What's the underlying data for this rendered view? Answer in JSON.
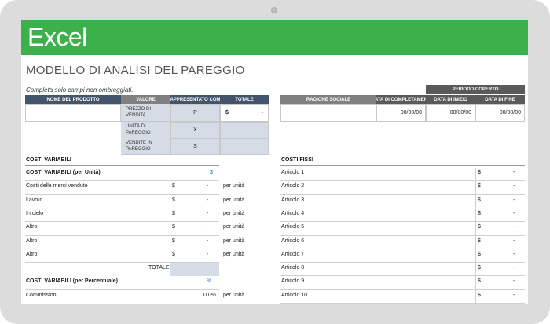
{
  "app": {
    "name": "Excel",
    "accent": "#3cb04b"
  },
  "page_title": "MODELLO DI ANALISI DEL PAREGGIO",
  "instructions": "Completa solo campi non ombreggiati.",
  "product_table": {
    "headers": [
      "NOME DEL PRODOTTO",
      "VALORE",
      "APPRESENTATO COM",
      "TOTALE"
    ],
    "rows": [
      {
        "label": "PREZZO DI VENDITA",
        "symbol": "P"
      },
      {
        "label": "UNITÀ DI PAREGGIO",
        "symbol": "X"
      },
      {
        "label": "VENDITE IN PAREGGIO",
        "symbol": "S"
      }
    ],
    "total_currency": "$",
    "total_value": "-"
  },
  "period_table": {
    "title": "PERIODO COPERTO",
    "headers": [
      "RAGIONE SOCIALE",
      "ATA DI COMPLETAMEN",
      "DATA DI INIZIO",
      "DATA DI FINE"
    ],
    "dates": [
      "00/00/00",
      "00/00/00",
      "00/00/00"
    ]
  },
  "variable_costs": {
    "title": "COSTI VARIABILI",
    "per_unit_title": "COSTI VARIABILI (per Unità)",
    "per_unit_symbol": "$",
    "unit_suffix": "per unità",
    "currency": "$",
    "items": [
      {
        "label": "Costi delle merci vendute",
        "value": "-"
      },
      {
        "label": "Lavoro",
        "value": "-"
      },
      {
        "label": "In cielo",
        "value": "-"
      },
      {
        "label": "Altro",
        "value": "-"
      },
      {
        "label": "Altro",
        "value": "-"
      },
      {
        "label": "Altro",
        "value": "-"
      }
    ],
    "total_label": "TOTALE",
    "percent_title": "COSTI VARIABILI (per Percentuale)",
    "percent_symbol": "%",
    "commission_label": "Commissioni",
    "commission_value": "0.0%"
  },
  "fixed_costs": {
    "title": "COSTI FISSI",
    "currency": "$",
    "items": [
      {
        "label": "Articolo 1",
        "value": "-"
      },
      {
        "label": "Articolo 2",
        "value": "-"
      },
      {
        "label": "Articolo 3",
        "value": "-"
      },
      {
        "label": "Articolo 4",
        "value": "-"
      },
      {
        "label": "Articolo 5",
        "value": "-"
      },
      {
        "label": "Articolo 6",
        "value": "-"
      },
      {
        "label": "Articolo 7",
        "value": "-"
      },
      {
        "label": "Articolo 8",
        "value": "-"
      },
      {
        "label": "Articolo 9",
        "value": "-"
      },
      {
        "label": "Articolo 10",
        "value": "-"
      }
    ]
  }
}
